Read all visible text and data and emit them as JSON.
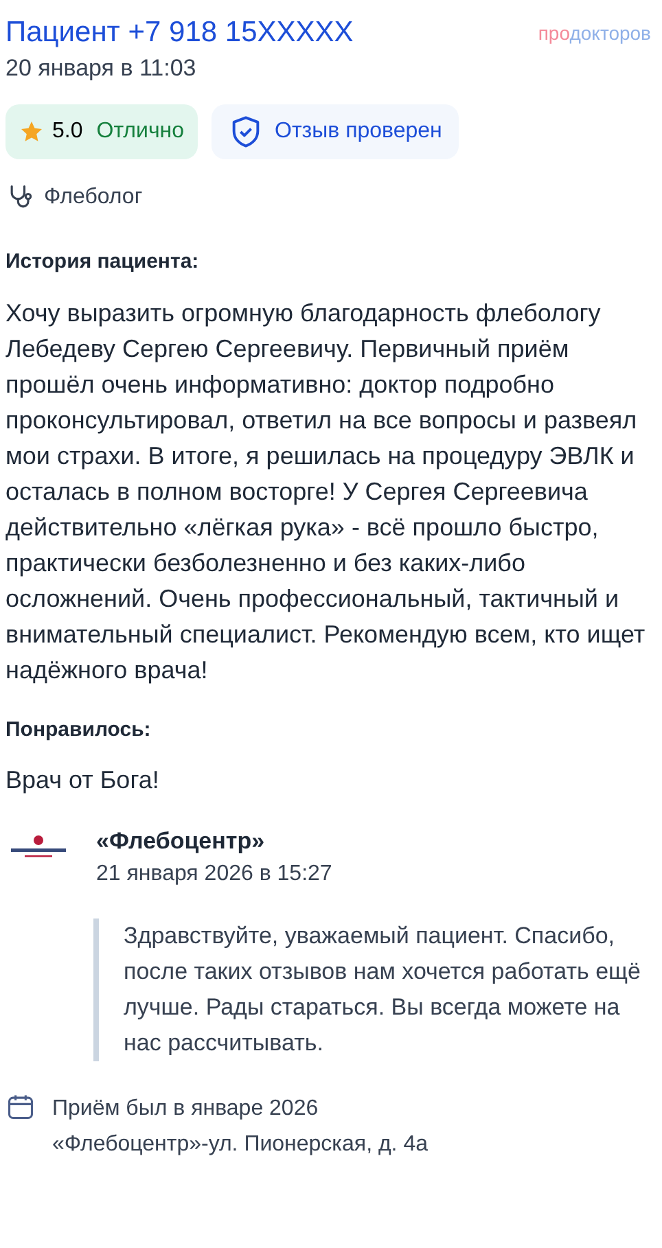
{
  "header": {
    "title": "Пациент +7 918 15XXXXX",
    "date": "20 января в 11:03",
    "logo": {
      "part_1": "про",
      "part_2": "докторов"
    }
  },
  "badges": {
    "rating": {
      "value": "5.0",
      "label": "Отлично"
    },
    "verified": {
      "label": "Отзыв проверен"
    }
  },
  "specialty": "Флеболог",
  "story": {
    "heading": "История пациента:",
    "text": "Хочу выразить огромную благодарность флебологу Лебедеву Сергею Сергеевичу. Первичный приём прошёл очень информативно: доктор подробно проконсультировал, ответил на все вопросы и развеял мои страхи. В итоге, я решилась на процедуру ЭВЛК и осталась в полном восторге! У Сергея Сергеевича действительно «лёгкая рука» - всё прошло быстро, практически безболезненно и без каких-либо осложнений. Очень профессиональный, тактичный и внимательный специалист. Рекомендую всем, кто ищет надёжного врача!"
  },
  "liked": {
    "heading": "Понравилось:",
    "text": "Врач от Бога!"
  },
  "reply": {
    "author": "«Флебоцентр»",
    "date": "21 января 2026 в 15:27",
    "text": "Здравствуйте, уважаемый пациент. Спасибо, после таких отзывов нам хочется работать ещё лучше. Рады стараться. Вы всегда можете на нас рассчитывать."
  },
  "visit": {
    "date": "Приём был в январе 2026",
    "clinic": "«Флебоцентр»-ул. Пионерская, д. 4а"
  }
}
